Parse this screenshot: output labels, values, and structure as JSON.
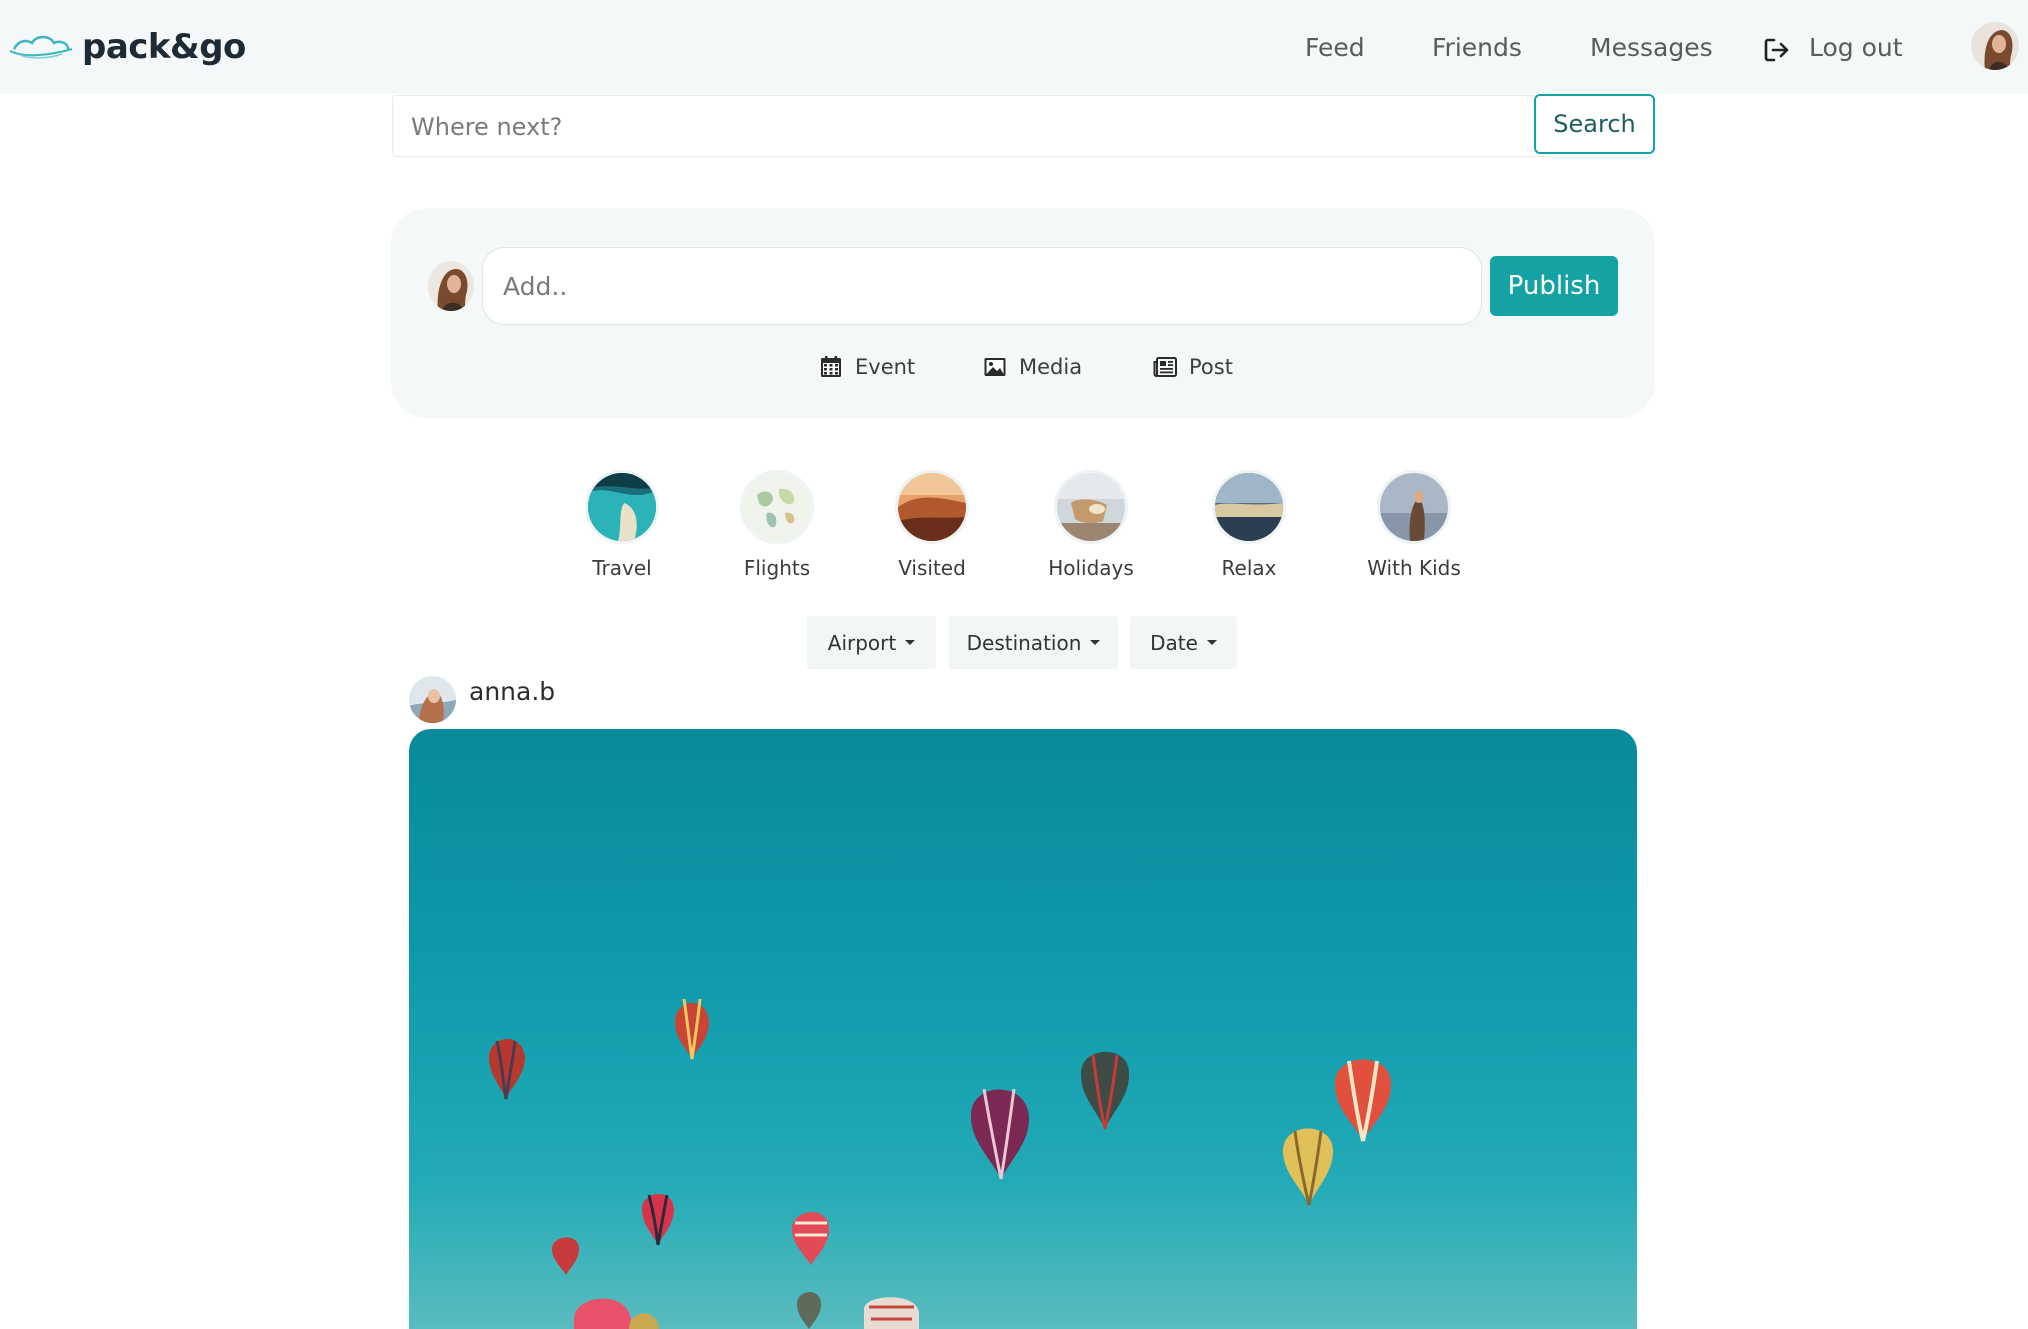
{
  "header": {
    "brand_name": "pack&go",
    "brand_icon": "cloud-swirl-logo",
    "nav_items": [
      {
        "label": "Feed"
      },
      {
        "label": "Friends"
      },
      {
        "label": "Messages"
      },
      {
        "label": "Log out",
        "icon": "logout-icon"
      }
    ],
    "avatar_icon": "user-avatar"
  },
  "search": {
    "placeholder": "Where next?",
    "button_label": "Search"
  },
  "composer": {
    "placeholder": "Add..",
    "publish_label": "Publish",
    "actions": [
      {
        "label": "Event",
        "icon": "calendar-icon"
      },
      {
        "label": "Media",
        "icon": "image-icon"
      },
      {
        "label": "Post",
        "icon": "newspaper-icon"
      }
    ]
  },
  "categories": [
    {
      "label": "Travel"
    },
    {
      "label": "Flights"
    },
    {
      "label": "Visited"
    },
    {
      "label": "Holidays"
    },
    {
      "label": "Relax"
    },
    {
      "label": "With Kids"
    }
  ],
  "filters": [
    {
      "label": "Airport"
    },
    {
      "label": "Destination"
    },
    {
      "label": "Date"
    }
  ],
  "post": {
    "username": "anna.b",
    "image": "hot-air-balloons-photo"
  },
  "colors": {
    "accent": "#14a2a3",
    "nav_bg": "#f4f8f8",
    "brand_text": "#1d2b36"
  }
}
